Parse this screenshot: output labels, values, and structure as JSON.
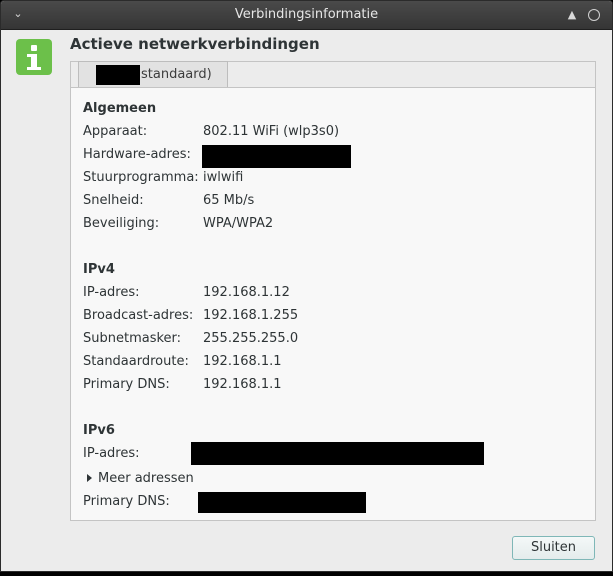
{
  "window": {
    "title": "Verbindingsinformatie"
  },
  "dialog": {
    "heading": "Actieve netwerkverbindingen",
    "tab_label": "standaard)",
    "close_button": "Sluiten"
  },
  "general": {
    "title": "Algemeen",
    "rows": [
      {
        "label": "Apparaat:",
        "value": "802.11 WiFi (wlp3s0)"
      },
      {
        "label": "Hardware-adres:",
        "value": ""
      },
      {
        "label": "Stuurprogramma:",
        "value": "iwlwifi"
      },
      {
        "label": "Snelheid:",
        "value": "65 Mb/s"
      },
      {
        "label": "Beveiliging:",
        "value": "WPA/WPA2"
      }
    ]
  },
  "ipv4": {
    "title": "IPv4",
    "rows": [
      {
        "label": "IP-adres:",
        "value": "192.168.1.12"
      },
      {
        "label": "Broadcast-adres:",
        "value": "192.168.1.255"
      },
      {
        "label": "Subnetmasker:",
        "value": "255.255.255.0"
      },
      {
        "label": "Standaardroute:",
        "value": "192.168.1.1"
      },
      {
        "label": "Primary DNS:",
        "value": "192.168.1.1"
      }
    ]
  },
  "ipv6": {
    "title": "IPv6",
    "ip_label": "IP-adres:",
    "more_label": "Meer adressen",
    "dns_label": "Primary DNS:"
  }
}
